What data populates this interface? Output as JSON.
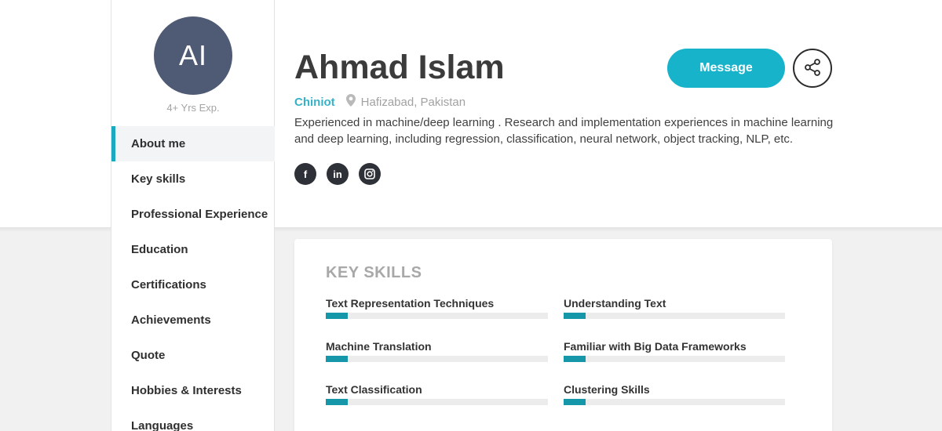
{
  "profile": {
    "initials": "AI",
    "experience": "4+ Yrs Exp.",
    "name": "Ahmad Islam",
    "city": "Chiniot",
    "region": "Hafizabad, Pakistan",
    "about": "Experienced in machine/deep learning . Research and implementation experiences in machine learning and deep learning, including regression, classification, neural network, object tracking, NLP, etc."
  },
  "sidebar": {
    "items": [
      {
        "label": "About me",
        "active": true
      },
      {
        "label": "Key skills"
      },
      {
        "label": "Professional Experience"
      },
      {
        "label": "Education"
      },
      {
        "label": "Certifications"
      },
      {
        "label": "Achievements"
      },
      {
        "label": "Quote"
      },
      {
        "label": "Hobbies & Interests"
      },
      {
        "label": "Languages"
      }
    ]
  },
  "actions": {
    "message_label": "Message",
    "share_icon": "share-icon"
  },
  "socials": [
    {
      "icon": "facebook-icon",
      "glyph": "f"
    },
    {
      "icon": "linkedin-icon",
      "glyph": "in"
    },
    {
      "icon": "instagram-icon",
      "glyph": ""
    }
  ],
  "key_skills": {
    "title": "KEY SKILLS",
    "skills": [
      {
        "name": "Text Representation Techniques",
        "level": 0.1
      },
      {
        "name": "Understanding Text",
        "level": 0.1
      },
      {
        "name": "Machine Translation",
        "level": 0.1
      },
      {
        "name": "Familiar with Big Data Frameworks",
        "level": 0.1
      },
      {
        "name": "Text Classification",
        "level": 0.1
      },
      {
        "name": "Clustering Skills",
        "level": 0.1
      }
    ]
  },
  "colors": {
    "accent": "#16b3cb",
    "avatar_bg": "#4f5a74",
    "skill_fill": "#1597a9"
  }
}
